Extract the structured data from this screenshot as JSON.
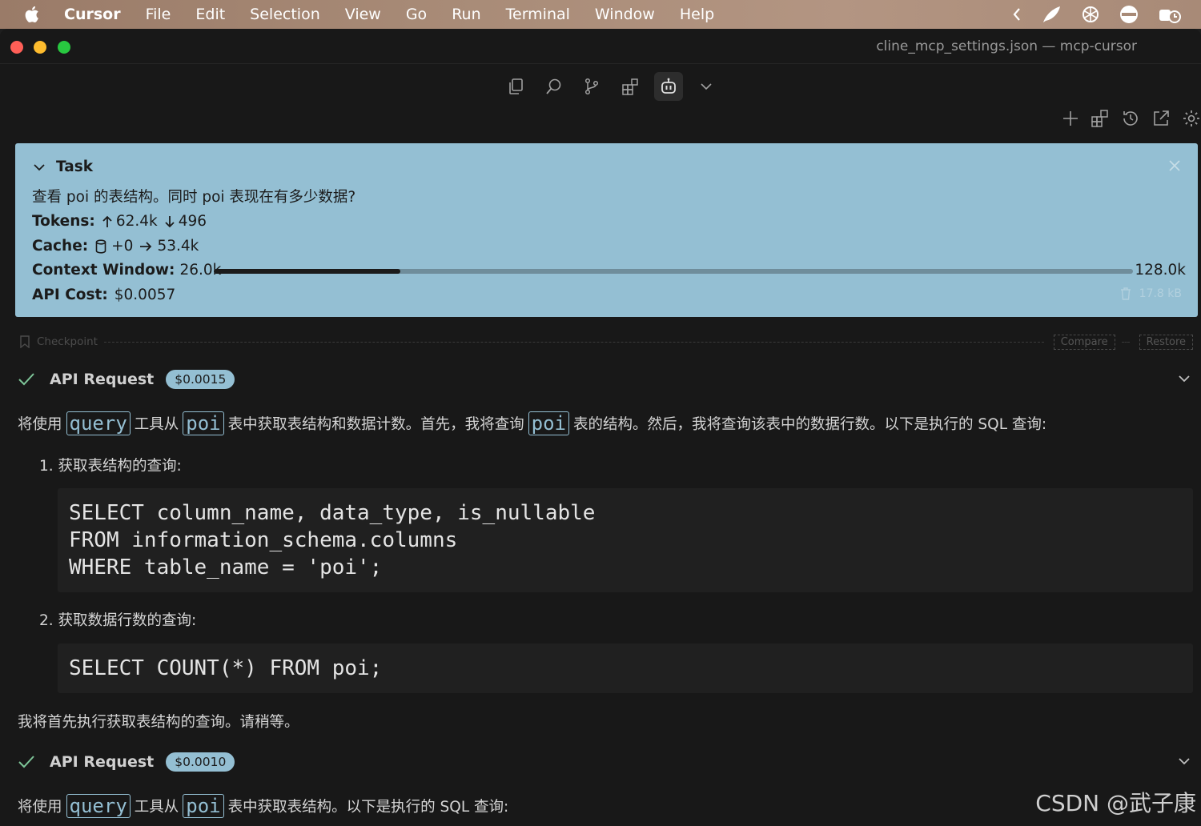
{
  "menubar": {
    "items": [
      "Cursor",
      "File",
      "Edit",
      "Selection",
      "View",
      "Go",
      "Run",
      "Terminal",
      "Window",
      "Help"
    ]
  },
  "window": {
    "title": "cline_mcp_settings.json — mcp-cursor"
  },
  "task": {
    "heading": "Task",
    "question": "查看 poi 的表结构。同时 poi 表现在有多少数据?",
    "tokens_label": "Tokens:",
    "tokens_up": "62.4k",
    "tokens_down": "496",
    "cache_label": "Cache:",
    "cache_write": "+0",
    "cache_read": "53.4k",
    "context_label": "Context Window:",
    "context_used": "26.0k",
    "context_max": "128.0k",
    "context_fraction": 0.203,
    "api_cost_label": "API Cost:",
    "api_cost": "$0.0057",
    "size": "17.8 kB"
  },
  "checkpoint": {
    "label": "Checkpoint",
    "compare": "Compare",
    "restore": "Restore"
  },
  "requests": [
    {
      "title": "API Request",
      "cost": "$0.0015"
    },
    {
      "title": "API Request",
      "cost": "$0.0010"
    }
  ],
  "message1": {
    "p1": "将使用",
    "c1": "query",
    "p2": "工具从",
    "c2": "poi",
    "p3": "表中获取表结构和数据计数。首先，我将查询",
    "c3": "poi",
    "p4": "表的结构。然后，我将查询该表中的数据行数。以下是执行的 SQL 查询:",
    "list1": "1. 获取表结构的查询:",
    "code1": [
      "SELECT column_name, data_type, is_nullable",
      "FROM information_schema.columns",
      "WHERE table_name = 'poi';"
    ],
    "list2": "2. 获取数据行数的查询:",
    "code2": [
      "SELECT COUNT(*) FROM poi;"
    ],
    "closing": "我将首先执行获取表结构的查询。请稍等。"
  },
  "message2": {
    "p1": "将使用",
    "c1": "query",
    "p2": "工具从",
    "c2": "poi",
    "p3": "表中获取表结构。以下是执行的 SQL 查询:"
  },
  "watermark": "CSDN @武子康",
  "colors": {
    "accent": "#94bfd3",
    "background": "#181818",
    "check": "#7ec699"
  }
}
